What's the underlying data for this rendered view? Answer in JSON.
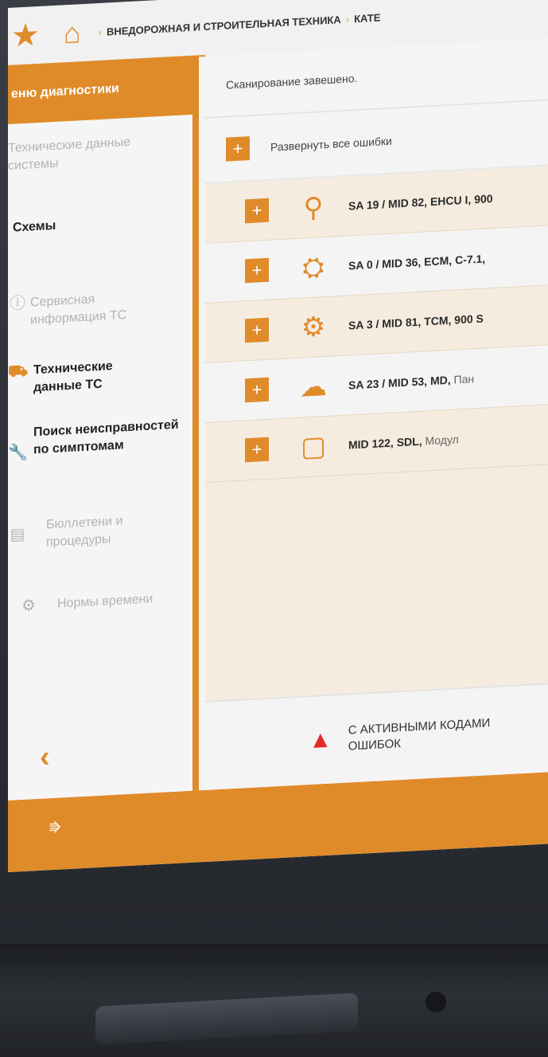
{
  "topbar": {
    "favorite_icon": "star-icon",
    "home_icon": "home-icon",
    "breadcrumb": [
      "ВНЕДОРОЖНАЯ И СТРОИТЕЛЬНАЯ ТЕХНИКА",
      "КАТЕ"
    ]
  },
  "sidebar": {
    "header": "еню диагностики",
    "items": [
      {
        "label": "Технические данные системы",
        "icon": "none",
        "state": "dim"
      },
      {
        "label": "Схемы",
        "icon": "none",
        "state": "active"
      },
      {
        "label": "Сервисная информация ТС",
        "icon": "info-icon",
        "state": "dim"
      },
      {
        "label": "Технические данные ТС",
        "icon": "vehicle-icon",
        "state": "active"
      },
      {
        "label": "Поиск неисправностей по симптомам",
        "icon": "wrench-icon",
        "state": "active"
      },
      {
        "label": "Бюллетени и процедуры",
        "icon": "document-icon",
        "state": "dim"
      },
      {
        "label": "Нормы времени",
        "icon": "clock-icon",
        "state": "dim"
      }
    ],
    "back_icon": "chevron-left-icon"
  },
  "footer": {
    "usb_icon": "usb-icon"
  },
  "content": {
    "status": "Сканирование завешено.",
    "expand_all": "Развернуть все ошибки",
    "rows": [
      {
        "id": "SA 19 / MID 82, EHCU I, 900",
        "desc": "",
        "icon": "hydraulic-cylinder-icon"
      },
      {
        "id": "SA 0 / MID 36, ECM, C-7.1,",
        "desc": "",
        "icon": "engine-icon"
      },
      {
        "id": "SA 3 / MID 81, TCM, 900 S",
        "desc": "",
        "icon": "gears-icon"
      },
      {
        "id": "SA 23 / MID 53, MD,",
        "desc": "Пан",
        "icon": "cloud-module-icon"
      },
      {
        "id": "MID 122, SDL,",
        "desc": "Модул",
        "icon": "wireless-module-icon"
      }
    ],
    "alert": "С АКТИВНЫМИ КОДАМИ ОШИБОК"
  },
  "colors": {
    "accent": "#e08b2a",
    "alert": "#e32b2b"
  }
}
